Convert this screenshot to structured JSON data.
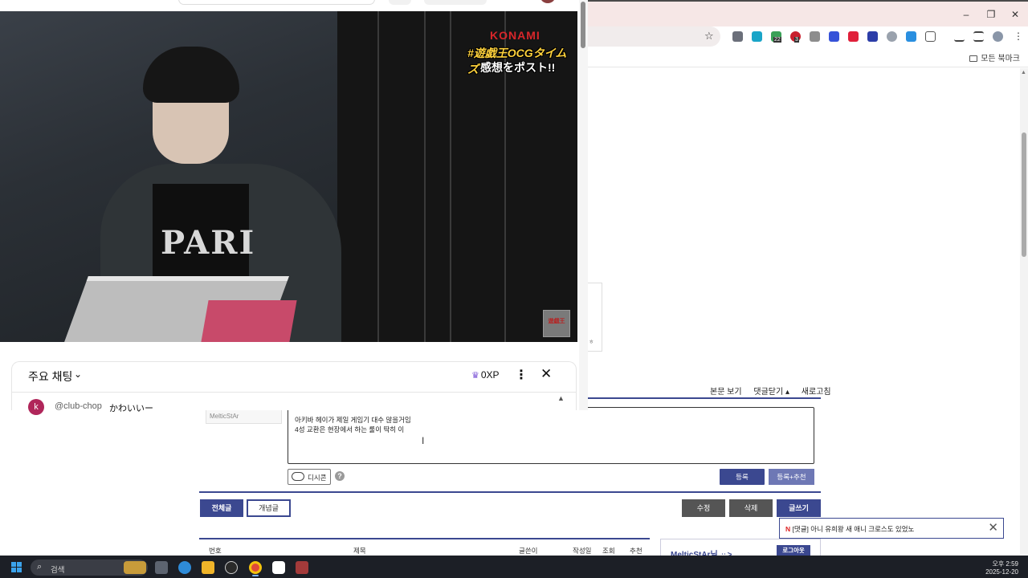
{
  "background_browser": {
    "window_controls": {
      "minimize": "–",
      "restore": "❐",
      "close": "✕"
    },
    "star_icon": "☆",
    "extension_badges": [
      "22",
      "3"
    ],
    "bookmarks_all": "모든 북마크",
    "colors": {
      "titlebar": "#f6e7e6"
    }
  },
  "board": {
    "side_char": "ㅎ",
    "comment_tools": [
      "본문 보기",
      "댓글닫기 ▴",
      "새로고침"
    ],
    "author_nick": "MelticStAr",
    "comment_lines": [
      "아키바 헤이가 제일 게임기 대수 많을거임",
      "4성 교환은 현장에서 하는 룰이 딱히 이"
    ],
    "dccon_label": "디시콘",
    "help_label": "?",
    "register_label": "등록",
    "register_recommend_label": "등록+추천",
    "all_posts_label": "전체글",
    "concept_label": "개념글",
    "edit_label": "수정",
    "delete_label": "삭제",
    "write_label": "글쓰기",
    "table_headers": [
      "번호",
      "제목",
      "글쓴이",
      "작성일",
      "조회",
      "추천"
    ],
    "user_name": "MelticStAr님 ᆢ>",
    "logout_label": "로그아웃",
    "accent_color": "#3b4890"
  },
  "toast": {
    "mark": "N",
    "text": "[댓글] 아니 유희왕 새 애니 크로스도 있었노",
    "close": "✕"
  },
  "youtube": {
    "video_overlay": {
      "brand": "KONAMI",
      "hashtag": "#遊戯王OCGタイムズ",
      "subtitle": "感想をポスト!!",
      "shirt_text": "PARI",
      "corner_logo": "遊戯王"
    },
    "chat": {
      "title": "주요 채팅",
      "chevron": "⌄",
      "xp": "0XP",
      "more": "⋮",
      "close": "✕",
      "scroll_up": "▲",
      "messages": [
        {
          "avatar": "k",
          "author": "@club-chop",
          "text": "かわいいー"
        }
      ]
    }
  },
  "taskbar": {
    "search_placeholder": "검색",
    "time": "오후 2:59",
    "date": "2025-12-20"
  }
}
